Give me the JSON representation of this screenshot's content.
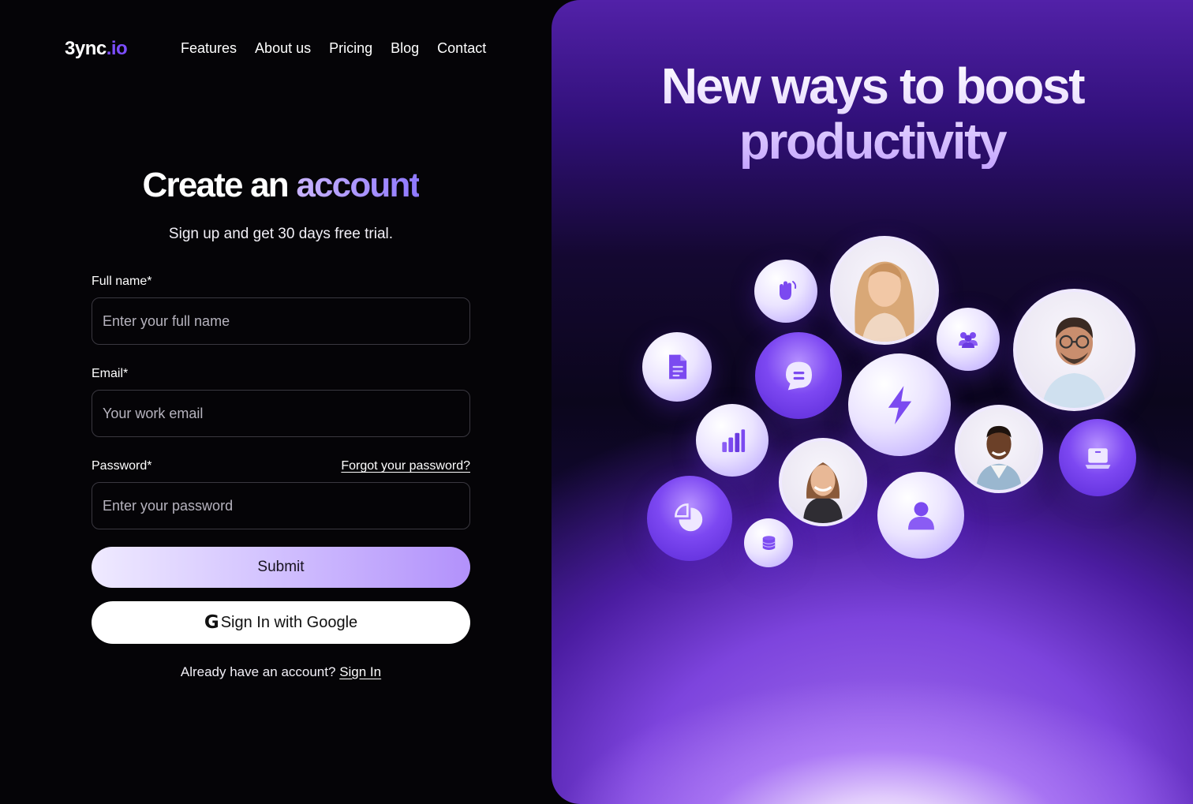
{
  "brand": {
    "name": "3ync",
    "suffix": ".io"
  },
  "nav": {
    "items": [
      "Features",
      "About us",
      "Pricing",
      "Blog",
      "Contact"
    ]
  },
  "form_header": {
    "title_main": "Create an",
    "title_accent": "account",
    "subtitle": "Sign up and get 30 days free trial."
  },
  "form": {
    "full_name_label": "Full name*",
    "full_name_placeholder": "Enter your full name",
    "email_label": "Email*",
    "email_placeholder": "Your work email",
    "password_label": "Password*",
    "forgot_label": "Forgot your password?",
    "password_placeholder": "Enter your password",
    "submit_label": "Submit",
    "google_glyph": "G",
    "google_label": "Sign In with Google",
    "have_account_text": "Already have an account?",
    "signin_link": "Sign In"
  },
  "hero": {
    "line1": "New ways to boost",
    "line2": "productivity"
  },
  "bubbles": [
    "hand-wave-icon",
    "woman-blonde-avatar",
    "group-icon",
    "man-glasses-avatar",
    "document-icon",
    "chat-icon",
    "lightning-icon",
    "bar-chart-icon",
    "woman-avatar",
    "man-avatar",
    "laptop-icon",
    "pie-chart-icon",
    "database-icon",
    "user-icon"
  ],
  "colors": {
    "accent": "#7c4dff",
    "background": "#050407",
    "panel": "#5b2ad6"
  }
}
